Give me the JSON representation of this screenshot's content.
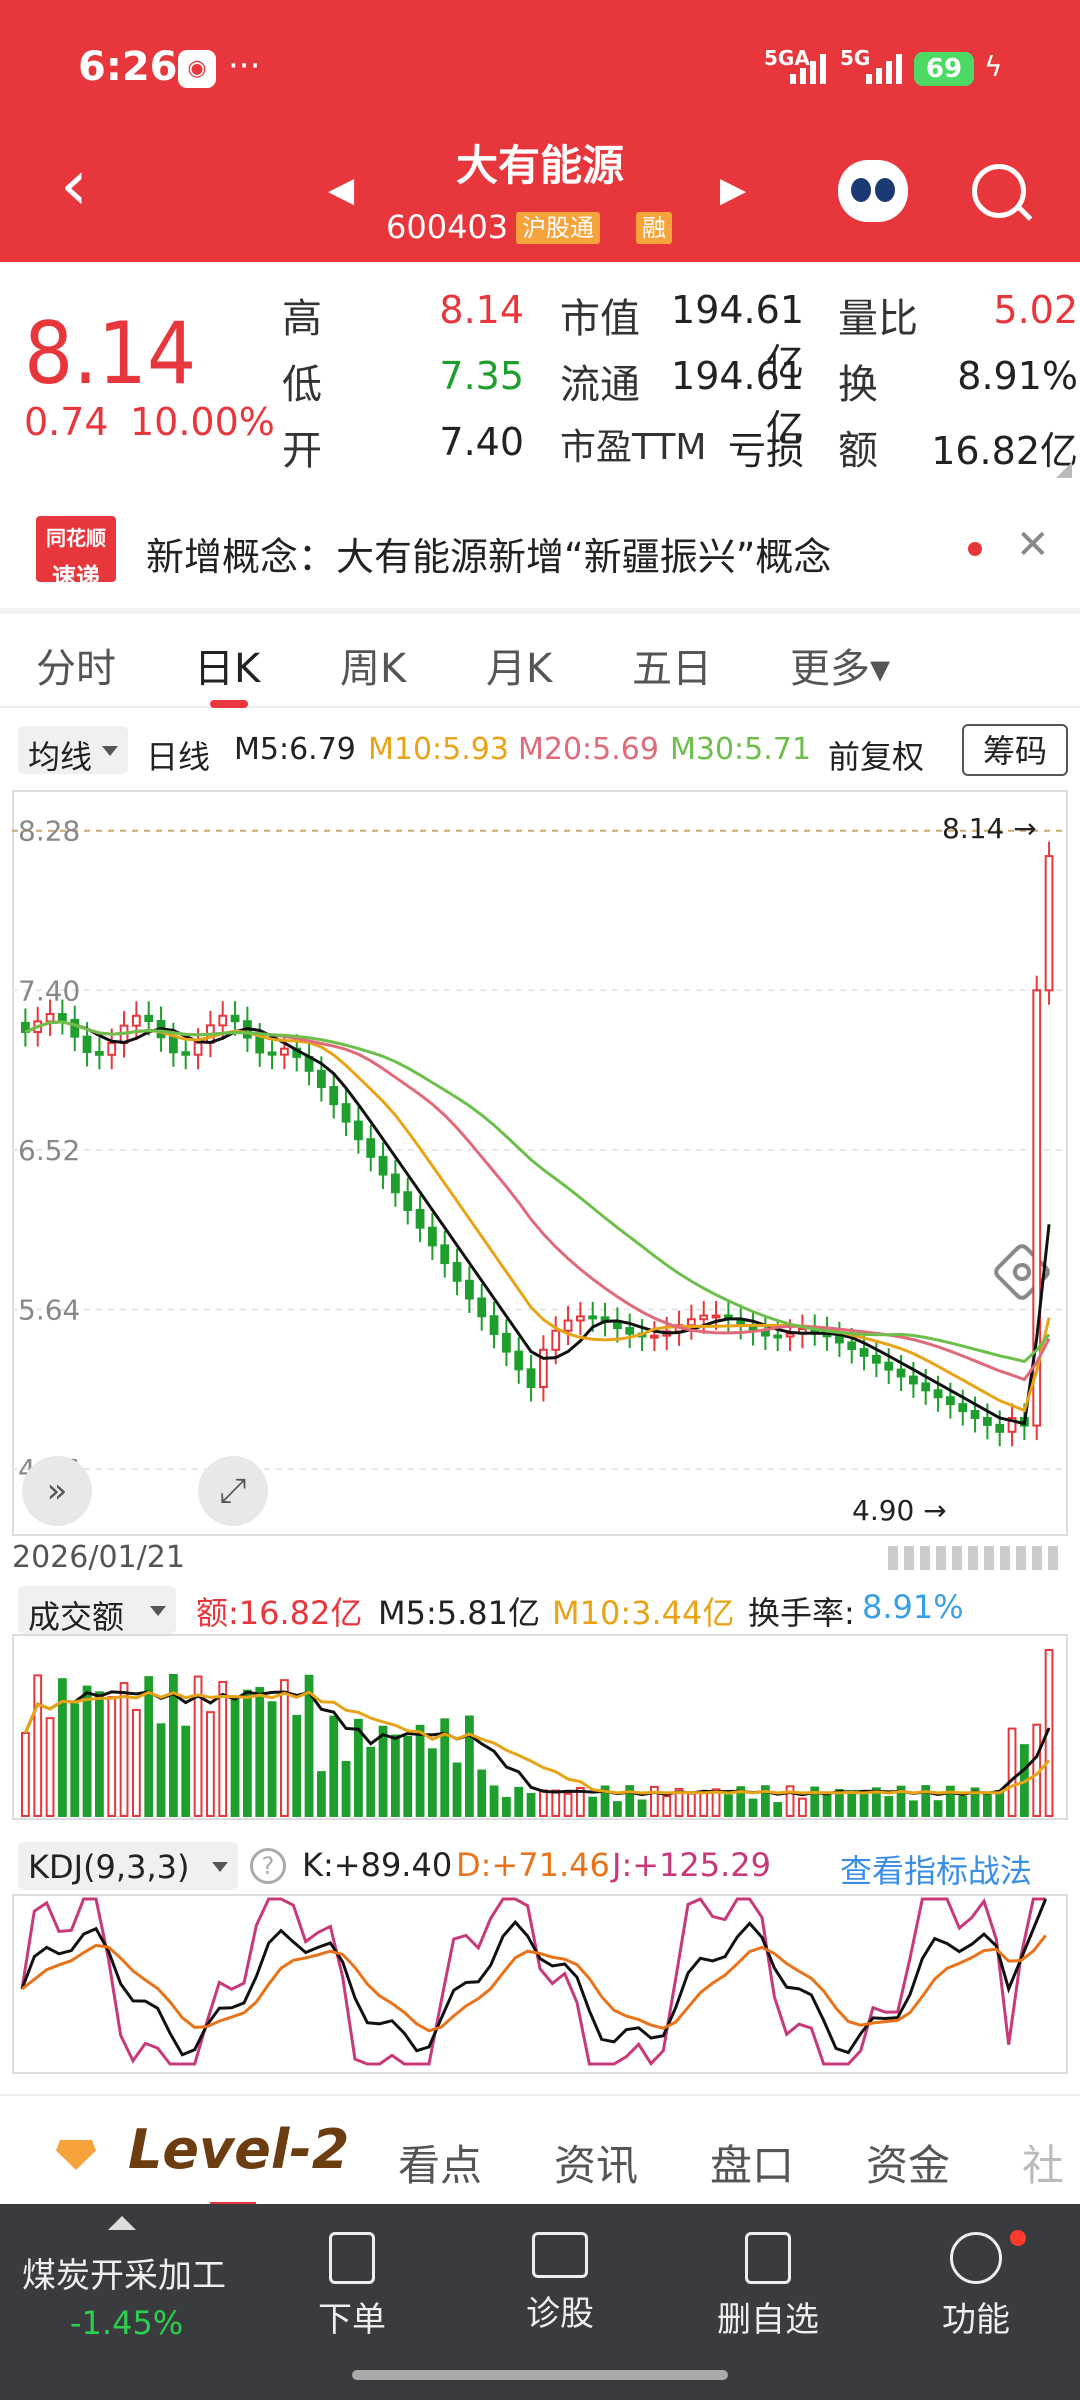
{
  "status": {
    "time": "6:26",
    "net1": "5GA",
    "net2": "5G",
    "battery": "69"
  },
  "header": {
    "title": "大有能源",
    "code": "600403",
    "tag1": "沪股通",
    "tag2": "融"
  },
  "quote": {
    "price": "8.14",
    "change": "0.74",
    "change_pct": "10.00%",
    "high_label": "高",
    "high": "8.14",
    "low_label": "低",
    "low": "7.35",
    "open_label": "开",
    "open": "7.40",
    "mcap_label": "市值",
    "mcap": "194.61亿",
    "float_label": "流通",
    "float": "194.61亿",
    "pe_label": "市盈TTM",
    "pe": "亏损",
    "vr_label": "量比",
    "vr": "5.02",
    "turn_label": "换",
    "turn": "8.91%",
    "amt_label": "额",
    "amt": "16.82亿"
  },
  "news": {
    "logo_top": "同花顺",
    "logo_bottom": "速递",
    "text": "新增概念：大有能源新增“新疆振兴”概念"
  },
  "tabs": [
    "分时",
    "日K",
    "周K",
    "月K",
    "五日",
    "更多▾"
  ],
  "ma_bar": {
    "select": "均线",
    "period": "日线",
    "m5": "M5:6.79",
    "m10": "M10:5.93",
    "m20": "M20:5.69",
    "m30": "M30:5.71",
    "adj": "前复权",
    "chip": "筹码"
  },
  "price_chart": {
    "high_label": "8.14",
    "low_label": "4.90",
    "date": "2026/01/21",
    "y_ticks": [
      "8.28",
      "7.40",
      "6.52",
      "5.64",
      "4.76"
    ]
  },
  "vol_bar": {
    "select": "成交额",
    "amt": "额:16.82亿",
    "m5": "M5:5.81亿",
    "m10": "M10:3.44亿",
    "turn_label": "换手率:",
    "turn": "8.91%"
  },
  "kdj_bar": {
    "select": "KDJ(9,3,3)",
    "q": "?",
    "k": "K:+89.40",
    "d": "D:+71.46",
    "j": "J:+125.29",
    "link": "查看指标战法"
  },
  "bottom_tabs": {
    "level2": "Level-2",
    "items": [
      "看点",
      "资讯",
      "盘口",
      "资金",
      "社"
    ]
  },
  "dock": {
    "sector": "煤炭开采加工",
    "sector_chg": "-1.45%",
    "items": [
      "下单",
      "诊股",
      "删自选",
      "功能"
    ]
  },
  "colors": {
    "red": "#e8373c",
    "green": "#1e9e2d",
    "m10": "#e8a317",
    "m20": "#e06a7a",
    "m30": "#6cbf4a",
    "kdj_link": "#3a8ee6"
  }
}
